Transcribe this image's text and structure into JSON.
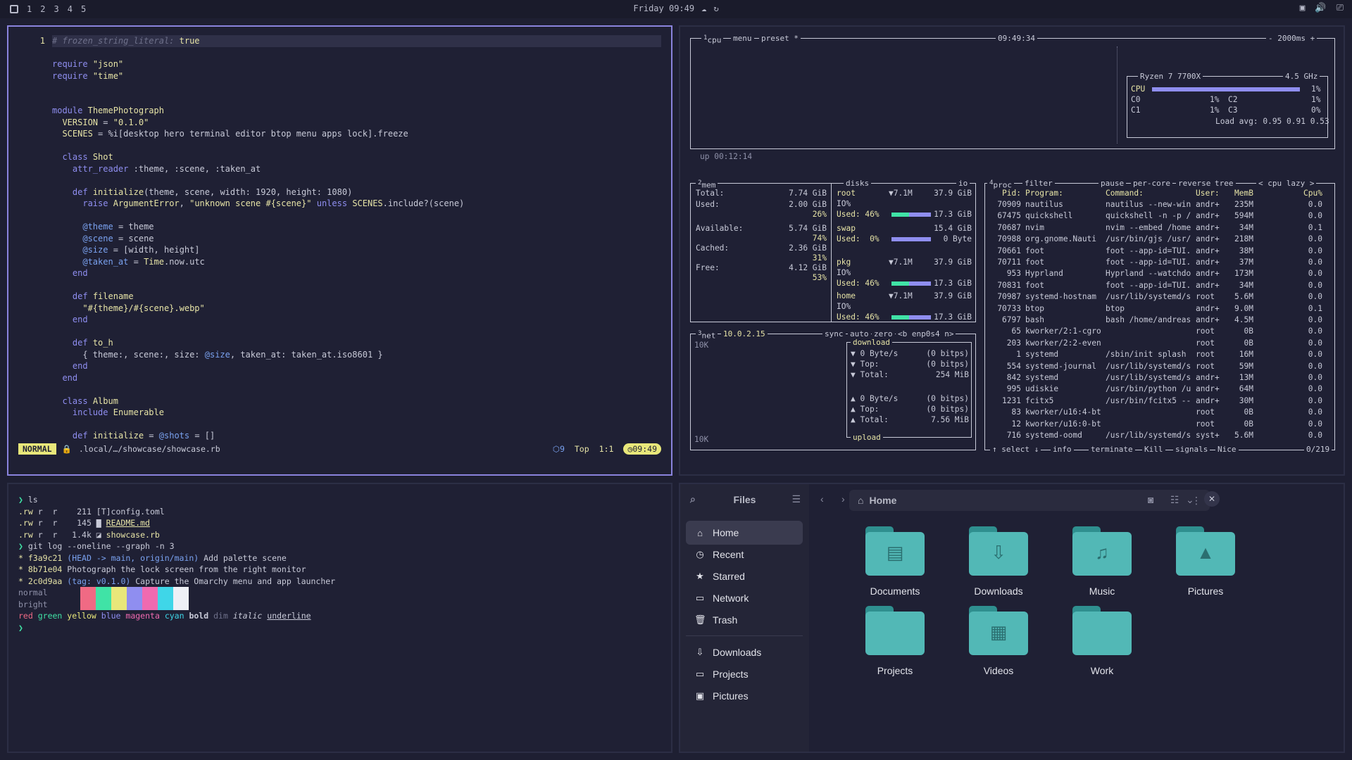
{
  "topbar": {
    "workspaces": [
      "1",
      "2",
      "3",
      "4",
      "5"
    ],
    "clock": "Friday 09:49",
    "tray_icons": [
      "screen-icon",
      "volume-icon",
      "display-icon"
    ]
  },
  "editor": {
    "lines": [
      {
        "n": "1",
        "t": "# frozen_string_literal: true"
      },
      {
        "n": "",
        "t": ""
      },
      {
        "n": "",
        "t": "require \"json\""
      },
      {
        "n": "",
        "t": "require \"time\""
      },
      {
        "n": "",
        "t": ""
      },
      {
        "n": "",
        "t": ""
      },
      {
        "n": "",
        "t": "module ThemePhotograph"
      },
      {
        "n": "",
        "t": "  VERSION = \"0.1.0\""
      },
      {
        "n": "",
        "t": "  SCENES = %i[desktop hero terminal editor btop menu apps lock].freeze"
      },
      {
        "n": "",
        "t": ""
      },
      {
        "n": "",
        "t": "  class Shot"
      },
      {
        "n": "",
        "t": "    attr_reader :theme, :scene, :taken_at"
      },
      {
        "n": "",
        "t": ""
      },
      {
        "n": "",
        "t": "    def initialize(theme, scene, width: 1920, height: 1080)"
      },
      {
        "n": "",
        "t": "      raise ArgumentError, \"unknown scene #{scene}\" unless SCENES.include?(scene)"
      },
      {
        "n": "",
        "t": ""
      },
      {
        "n": "",
        "t": "      @theme = theme"
      },
      {
        "n": "",
        "t": "      @scene = scene"
      },
      {
        "n": "",
        "t": "      @size = [width, height]"
      },
      {
        "n": "",
        "t": "      @taken_at = Time.now.utc"
      },
      {
        "n": "",
        "t": "    end"
      },
      {
        "n": "",
        "t": ""
      },
      {
        "n": "",
        "t": "    def filename"
      },
      {
        "n": "",
        "t": "      \"#{theme}/#{scene}.webp\""
      },
      {
        "n": "",
        "t": "    end"
      },
      {
        "n": "",
        "t": ""
      },
      {
        "n": "",
        "t": "    def to_h"
      },
      {
        "n": "",
        "t": "      { theme:, scene:, size: @size, taken_at: taken_at.iso8601 }"
      },
      {
        "n": "",
        "t": "    end"
      },
      {
        "n": "",
        "t": "  end"
      },
      {
        "n": "",
        "t": ""
      },
      {
        "n": "",
        "t": "  class Album"
      },
      {
        "n": "",
        "t": "    include Enumerable"
      },
      {
        "n": "",
        "t": ""
      },
      {
        "n": "",
        "t": "    def initialize = @shots = []"
      }
    ],
    "status": {
      "mode": "NORMAL",
      "path": ".local/…/showcase/showcase.rb",
      "diag": "9",
      "position": "Top",
      "cursor": "1:1",
      "time": "09:49"
    }
  },
  "btop": {
    "cpu_box": {
      "tab_num": "1",
      "tab": "cpu",
      "menu": "menu",
      "preset": "preset *",
      "time": "09:49:34",
      "interval": "- 2000ms +",
      "uptime": "up 00:12:14"
    },
    "cpu_info": {
      "model": "Ryzen 7 7700X",
      "freq": "4.5 GHz",
      "cpu_label": "CPU",
      "cpu_pct": "1%",
      "cores": [
        {
          "n": "C0",
          "p": "1%"
        },
        {
          "n": "C2",
          "p": "1%"
        },
        {
          "n": "C1",
          "p": "1%"
        },
        {
          "n": "C3",
          "p": "0%"
        }
      ],
      "load": "Load avg: 0.95 0.91 0.53"
    },
    "mem": {
      "tab_num": "2",
      "title": "mem",
      "disks": "disks",
      "io": "io",
      "rows": [
        {
          "l": "Total:",
          "v": "7.74 GiB"
        },
        {
          "l": "Used:",
          "v": "2.00 GiB",
          "p": "26%"
        },
        {
          "l": "Available:",
          "v": "5.74 GiB",
          "p": "74%"
        },
        {
          "l": "Cached:",
          "v": "2.36 GiB",
          "p": "31%"
        },
        {
          "l": "Free:",
          "v": "4.12 GiB",
          "p": "53%"
        }
      ],
      "disk_rows": [
        {
          "name": "root",
          "io": "▼7.1M",
          "size": "37.9 GiB",
          "ioline": "IO%",
          "used": "Used: 46%",
          "usedv": "17.3 GiB"
        },
        {
          "name": "swap",
          "io": "",
          "size": "15.4 GiB",
          "ioline": "",
          "used": "Used:  0%",
          "usedv": "0 Byte"
        },
        {
          "name": "pkg",
          "io": "▼7.1M",
          "size": "37.9 GiB",
          "ioline": "IO%",
          "used": "Used: 46%",
          "usedv": "17.3 GiB"
        },
        {
          "name": "home",
          "io": "▼7.1M",
          "size": "37.9 GiB",
          "ioline": "IO%",
          "used": "Used: 46%",
          "usedv": "17.3 GiB"
        }
      ]
    },
    "net": {
      "tab_num": "3",
      "title": "net",
      "ip": "10.0.2.15",
      "sync": "sync",
      "auto": "auto",
      "zero": "zero",
      "iface": "<b enp0s4 n>",
      "scale_top": "10K",
      "scale_bot": "10K",
      "download": "download",
      "upload": "upload",
      "down_rows": [
        {
          "l": "▼ 0 Byte/s",
          "v": "(0 bitps)"
        },
        {
          "l": "▼ Top:",
          "v": "(0 bitps)"
        },
        {
          "l": "▼ Total:",
          "v": "254 MiB"
        }
      ],
      "up_rows": [
        {
          "l": "▲ 0 Byte/s",
          "v": "(0 bitps)"
        },
        {
          "l": "▲ Top:",
          "v": "(0 bitps)"
        },
        {
          "l": "▲ Total:",
          "v": "7.56 MiB"
        }
      ]
    },
    "proc": {
      "tab_num": "4",
      "title": "proc",
      "filter": "filter",
      "pause": "pause",
      "percore": "per-core",
      "reverse": "reverse",
      "tree": "tree",
      "sort": "< cpu lazy >",
      "headers": {
        "pid": "Pid:",
        "prog": "Program:",
        "cmd": "Command:",
        "user": "User:",
        "mem": "MemB",
        "cpu": "Cpu%"
      },
      "rows": [
        {
          "pid": "70909",
          "prog": "nautilus",
          "cmd": "nautilus --new-win",
          "user": "andr+",
          "mem": "235M",
          "cpu": "0.0"
        },
        {
          "pid": "67475",
          "prog": "quickshell",
          "cmd": "quickshell -n -p /",
          "user": "andr+",
          "mem": "594M",
          "cpu": "0.0"
        },
        {
          "pid": "70687",
          "prog": "nvim",
          "cmd": "nvim --embed /home",
          "user": "andr+",
          "mem": "34M",
          "cpu": "0.1"
        },
        {
          "pid": "70988",
          "prog": "org.gnome.Nauti",
          "cmd": "/usr/bin/gjs /usr/",
          "user": "andr+",
          "mem": "218M",
          "cpu": "0.0"
        },
        {
          "pid": "70661",
          "prog": "foot",
          "cmd": "foot --app-id=TUI.",
          "user": "andr+",
          "mem": "38M",
          "cpu": "0.0"
        },
        {
          "pid": "70711",
          "prog": "foot",
          "cmd": "foot --app-id=TUI.",
          "user": "andr+",
          "mem": "37M",
          "cpu": "0.0"
        },
        {
          "pid": "953",
          "prog": "Hyprland",
          "cmd": "Hyprland --watchdo",
          "user": "andr+",
          "mem": "173M",
          "cpu": "0.0"
        },
        {
          "pid": "70831",
          "prog": "foot",
          "cmd": "foot --app-id=TUI.",
          "user": "andr+",
          "mem": "34M",
          "cpu": "0.0"
        },
        {
          "pid": "70987",
          "prog": "systemd-hostnam",
          "cmd": "/usr/lib/systemd/s",
          "user": "root",
          "mem": "5.6M",
          "cpu": "0.0"
        },
        {
          "pid": "70733",
          "prog": "btop",
          "cmd": "btop",
          "user": "andr+",
          "mem": "9.0M",
          "cpu": "0.1"
        },
        {
          "pid": "6797",
          "prog": "bash",
          "cmd": "bash /home/andreas",
          "user": "andr+",
          "mem": "4.5M",
          "cpu": "0.0"
        },
        {
          "pid": "65",
          "prog": "kworker/2:1-cgro",
          "cmd": "",
          "user": "root",
          "mem": "0B",
          "cpu": "0.0"
        },
        {
          "pid": "203",
          "prog": "kworker/2:2-even",
          "cmd": "",
          "user": "root",
          "mem": "0B",
          "cpu": "0.0"
        },
        {
          "pid": "1",
          "prog": "systemd",
          "cmd": "/sbin/init splash",
          "user": "root",
          "mem": "16M",
          "cpu": "0.0"
        },
        {
          "pid": "554",
          "prog": "systemd-journal",
          "cmd": "/usr/lib/systemd/s",
          "user": "root",
          "mem": "59M",
          "cpu": "0.0"
        },
        {
          "pid": "842",
          "prog": "systemd",
          "cmd": "/usr/lib/systemd/s",
          "user": "andr+",
          "mem": "13M",
          "cpu": "0.0"
        },
        {
          "pid": "995",
          "prog": "udiskie",
          "cmd": "/usr/bin/python /u",
          "user": "andr+",
          "mem": "64M",
          "cpu": "0.0"
        },
        {
          "pid": "1231",
          "prog": "fcitx5",
          "cmd": "/usr/bin/fcitx5 --",
          "user": "andr+",
          "mem": "30M",
          "cpu": "0.0"
        },
        {
          "pid": "83",
          "prog": "kworker/u16:4-bt",
          "cmd": "",
          "user": "root",
          "mem": "0B",
          "cpu": "0.0"
        },
        {
          "pid": "12",
          "prog": "kworker/u16:0-bt",
          "cmd": "",
          "user": "root",
          "mem": "0B",
          "cpu": "0.0"
        },
        {
          "pid": "716",
          "prog": "systemd-oomd",
          "cmd": "/usr/lib/systemd/s",
          "user": "syst+",
          "mem": "5.6M",
          "cpu": "0.0"
        }
      ],
      "footer": {
        "select": "↑ select ↓",
        "info": "info",
        "terminate": "terminate",
        "kill": "Kill",
        "signals": "signals",
        "nice": "Nice",
        "count": "0/219"
      }
    }
  },
  "terminal": {
    "lines": [
      {
        "t": "❯ ls"
      },
      {
        "t": ".rw r  r    211 [T]config.toml"
      },
      {
        "t": ".rw r  r    145 ▇ README.md"
      },
      {
        "t": ".rw r  r   1.4k ◪ showcase.rb"
      },
      {
        "t": "❯ git log --oneline --graph -n 3"
      },
      {
        "t": "* f3a9c21 (HEAD -> main, origin/main) Add palette scene"
      },
      {
        "t": "* 8b71e04 Photograph the lock screen from the right monitor"
      },
      {
        "t": "* 2c0d9aa (tag: v0.1.0) Capture the Omarchy menu and app launcher"
      }
    ],
    "palette_labels": [
      "normal",
      "bright"
    ],
    "palette_colors": [
      "#1f2034",
      "#f06a84",
      "#40e3a6",
      "#e8e77a",
      "#8f8ef0",
      "#f06ab0",
      "#3fd6e8",
      "#eef0f6"
    ],
    "styles": [
      "red",
      "green",
      "yellow",
      "blue",
      "magenta",
      "cyan",
      "bold",
      "dim",
      "italic",
      "underline"
    ],
    "style_colors": [
      "#f06a84",
      "#40e3a6",
      "#e8e77a",
      "#8f8ef0",
      "#f06ab0",
      "#3fd6e8"
    ],
    "prompt": "❯"
  },
  "files": {
    "title": "Files",
    "location": "Home",
    "sidebar": [
      {
        "label": "Home",
        "icon": "home-icon",
        "g": "⌂"
      },
      {
        "label": "Recent",
        "icon": "recent-icon",
        "g": "◷"
      },
      {
        "label": "Starred",
        "icon": "star-icon",
        "g": "★"
      },
      {
        "label": "Network",
        "icon": "network-icon",
        "g": "▭"
      },
      {
        "label": "Trash",
        "icon": "trash-icon",
        "g": "🗑"
      }
    ],
    "bookmarks": [
      {
        "label": "Downloads",
        "icon": "download-icon",
        "g": "⇩"
      },
      {
        "label": "Projects",
        "icon": "folder-icon",
        "g": "▭"
      },
      {
        "label": "Pictures",
        "icon": "image-icon",
        "g": "▣"
      }
    ],
    "folders": [
      {
        "label": "Documents",
        "icon": "document-icon",
        "g": "▤"
      },
      {
        "label": "Downloads",
        "icon": "download-icon",
        "g": "⇩"
      },
      {
        "label": "Music",
        "icon": "music-icon",
        "g": "♫"
      },
      {
        "label": "Pictures",
        "icon": "picture-icon",
        "g": "▲"
      },
      {
        "label": "Projects",
        "icon": "folder-icon",
        "g": ""
      },
      {
        "label": "Videos",
        "icon": "video-icon",
        "g": "▦"
      },
      {
        "label": "Work",
        "icon": "folder-icon",
        "g": ""
      }
    ]
  }
}
